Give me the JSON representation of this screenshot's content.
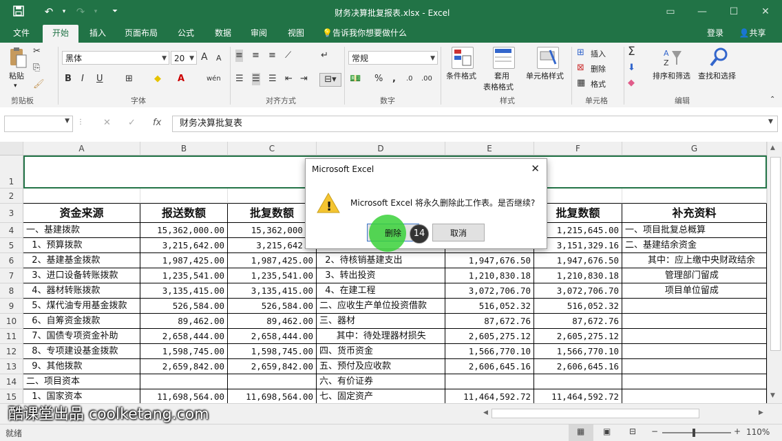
{
  "window": {
    "title": "财务决算批复报表.xlsx - Excel"
  },
  "tabs": [
    {
      "label": "文件"
    },
    {
      "label": "开始"
    },
    {
      "label": "插入"
    },
    {
      "label": "页面布局"
    },
    {
      "label": "公式"
    },
    {
      "label": "数据"
    },
    {
      "label": "审阅"
    },
    {
      "label": "视图"
    }
  ],
  "tell_me": "告诉我你想要做什么",
  "account": {
    "login": "登录",
    "share": "共享"
  },
  "ribbon": {
    "clipboard": {
      "paste": "粘贴",
      "label": "剪贴板"
    },
    "font": {
      "name": "黑体",
      "size": "20",
      "bold": "B",
      "italic": "I",
      "underline": "U",
      "label": "字体",
      "grow": "A",
      "shrink": "A",
      "phonetic": "wén"
    },
    "alignment": {
      "label": "对齐方式"
    },
    "number": {
      "format": "常规",
      "label": "数字",
      "percent": "%",
      "comma": ","
    },
    "styles": {
      "cond": "条件格式",
      "table1": "套用",
      "table2": "表格格式",
      "cell": "单元格样式",
      "label": "样式"
    },
    "cells": {
      "insert": "插入",
      "delete": "删除",
      "format": "格式",
      "label": "单元格"
    },
    "editing": {
      "sort": "排序和筛选",
      "find": "查找和选择",
      "label": "编辑",
      "sigma": "Σ"
    }
  },
  "formula_bar": {
    "fx": "fx",
    "value": "财务决算批复表",
    "cancel": "✕",
    "enter": "✓"
  },
  "columns": [
    {
      "name": "A"
    },
    {
      "name": "B"
    },
    {
      "name": "C"
    },
    {
      "name": "D"
    },
    {
      "name": "E"
    },
    {
      "name": "F"
    },
    {
      "name": "G"
    }
  ],
  "rows": [
    {
      "num": "1",
      "cells": [
        "",
        "",
        "",
        "",
        "",
        "",
        ""
      ]
    },
    {
      "num": "2",
      "cells": [
        "",
        "",
        "",
        "",
        "",
        "",
        ""
      ]
    },
    {
      "num": "3",
      "cells": [
        "资金来源",
        "报送数额",
        "批复数额",
        "",
        "",
        "批复数额",
        "补充资料"
      ]
    },
    {
      "num": "4",
      "cells": [
        "一、基建拨款",
        "15,362,000.00",
        "15,362,000.0",
        "",
        "",
        "1,215,645.00",
        "一、项目批复总概算"
      ]
    },
    {
      "num": "5",
      "cells": [
        "  1、预算拨款",
        "3,215,642.00",
        "3,215,642.0",
        "",
        "",
        "3,151,329.16",
        "二、基建结余资金"
      ]
    },
    {
      "num": "6",
      "cells": [
        "  2、基建基金拨款",
        "1,987,425.00",
        "1,987,425.00",
        "  2、待核销基建支出",
        "1,947,676.50",
        "1,947,676.50",
        "        其中：应上缴中央财政结余"
      ]
    },
    {
      "num": "7",
      "cells": [
        "  3、进口设备转账拨款",
        "1,235,541.00",
        "1,235,541.00",
        "  3、转出投资",
        "1,210,830.18",
        "1,210,830.18",
        "              管理部门留成"
      ]
    },
    {
      "num": "8",
      "cells": [
        "  4、器材转账拨款",
        "3,135,415.00",
        "3,135,415.00",
        "  4、在建工程",
        "3,072,706.70",
        "3,072,706.70",
        "              项目单位留成"
      ]
    },
    {
      "num": "9",
      "cells": [
        "  5、煤代油专用基金拨款",
        "526,584.00",
        "526,584.00",
        "二、应收生产单位投资借款",
        "516,052.32",
        "516,052.32",
        ""
      ]
    },
    {
      "num": "10",
      "cells": [
        "  6、自筹资金拨款",
        "89,462.00",
        "89,462.00",
        "三、器材",
        "87,672.76",
        "87,672.76",
        ""
      ]
    },
    {
      "num": "11",
      "cells": [
        "  7、国债专项资金补助",
        "2,658,444.00",
        "2,658,444.00",
        "      其中：待处理器材损失",
        "2,605,275.12",
        "2,605,275.12",
        ""
      ]
    },
    {
      "num": "12",
      "cells": [
        "  8、专项建设基金拨款",
        "1,598,745.00",
        "1,598,745.00",
        "四、货币资金",
        "1,566,770.10",
        "1,566,770.10",
        ""
      ]
    },
    {
      "num": "13",
      "cells": [
        "  9、其他拨款",
        "2,659,842.00",
        "2,659,842.00",
        "五、预付及应收款",
        "2,606,645.16",
        "2,606,645.16",
        ""
      ]
    },
    {
      "num": "14",
      "cells": [
        "二、项目资本",
        "",
        "",
        "六、有价证券",
        "",
        "",
        ""
      ]
    },
    {
      "num": "15",
      "cells": [
        "  1、国家资本",
        "11,698,564.00",
        "11,698,564.00",
        "七、固定资产",
        "11,464,592.72",
        "11,464,592.72",
        ""
      ]
    }
  ],
  "dialog": {
    "title": "Microsoft Excel",
    "message": "Microsoft Excel 将永久删除此工作表。是否继续?",
    "delete_label": "删除",
    "cancel_label": "取消",
    "step_badge": "14",
    "warning_glyph": "!"
  },
  "status": {
    "ready": "就绪",
    "zoom": "110%"
  },
  "watermark": "酷课堂出品 coolketang.com",
  "colors": {
    "excel_green": "#217346",
    "highlight": "#3ad13a"
  }
}
